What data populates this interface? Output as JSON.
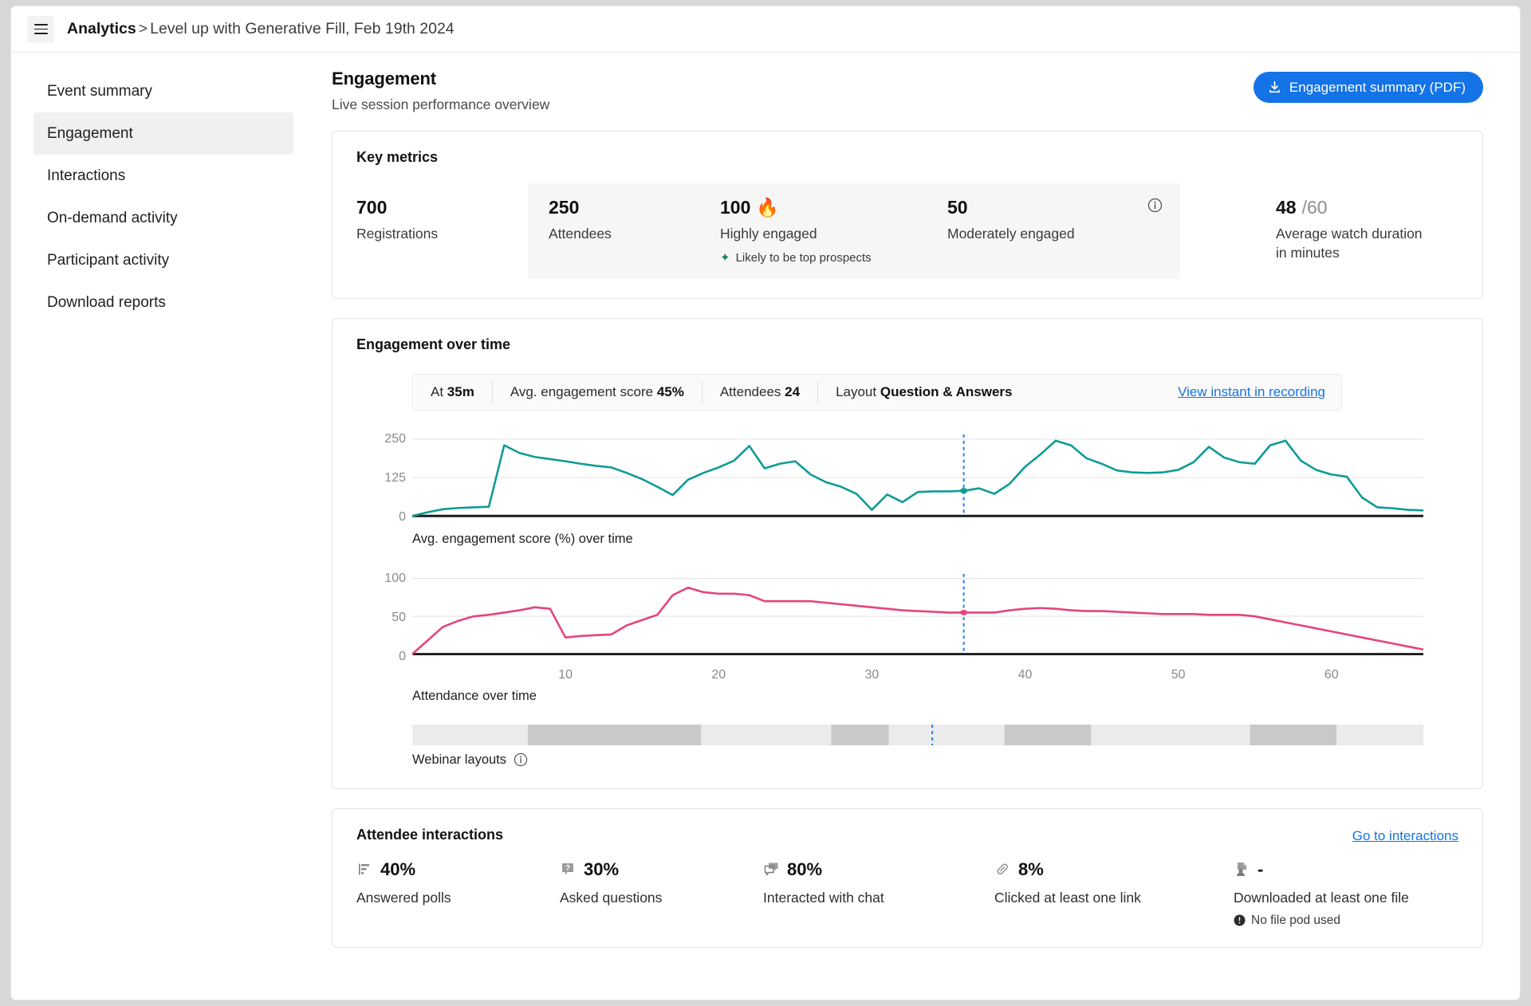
{
  "header": {
    "menu_icon": "hamburger-icon",
    "breadcrumb_root": "Analytics",
    "breadcrumb_sep": ">",
    "breadcrumb_current": "Level up with Generative Fill, Feb 19th 2024"
  },
  "sidebar": {
    "items": [
      {
        "label": "Event summary",
        "active": false
      },
      {
        "label": "Engagement",
        "active": true
      },
      {
        "label": "Interactions",
        "active": false
      },
      {
        "label": "On-demand activity",
        "active": false
      },
      {
        "label": "Participant activity",
        "active": false
      },
      {
        "label": "Download reports",
        "active": false
      }
    ]
  },
  "page": {
    "title": "Engagement",
    "subtitle": "Live session performance overview",
    "pdf_button": "Engagement summary (PDF)",
    "pdf_button_color": "#1473e6"
  },
  "key_metrics": {
    "title": "Key metrics",
    "registrations": {
      "value": "700",
      "label": "Registrations"
    },
    "attendees": {
      "value": "250",
      "label": "Attendees"
    },
    "highly_engaged": {
      "value": "100",
      "emoji": "🔥",
      "label": "Highly engaged",
      "note": "Likely to be top prospects",
      "note_icon": "sparkle-icon",
      "note_color": "#14855f"
    },
    "moderately_engaged": {
      "value": "50",
      "label": "Moderately engaged",
      "info_icon": "info-icon"
    },
    "avg_watch": {
      "value": "48",
      "total": "/60",
      "label_line1": "Average watch duration",
      "label_line2": "in minutes"
    }
  },
  "engagement_over_time": {
    "title": "Engagement over time",
    "tooltip": {
      "at_label": "At",
      "at_value": "35m",
      "score_label": "Avg. engagement score",
      "score_value": "45%",
      "attendees_label": "Attendees",
      "attendees_value": "24",
      "layout_label": "Layout",
      "layout_value": "Question & Answers",
      "link": "View instant in recording"
    },
    "caption_top": "Avg. engagement score (%) over time",
    "caption_bottom": "Attendance over time",
    "layouts_label": "Webinar layouts",
    "layouts_info_icon": "info-icon"
  },
  "attendee_interactions": {
    "title": "Attendee interactions",
    "link": "Go to interactions",
    "items": [
      {
        "icon": "poll-icon",
        "value": "40%",
        "label": "Answered polls"
      },
      {
        "icon": "question-icon",
        "value": "30%",
        "label": "Asked questions"
      },
      {
        "icon": "chat-icon",
        "value": "80%",
        "label": "Interacted with chat"
      },
      {
        "icon": "link-icon",
        "value": "8%",
        "label": "Clicked at least one link"
      },
      {
        "icon": "file-share-icon",
        "value": "-",
        "label": "Downloaded at least one file",
        "sub": "No file pod used",
        "sub_icon": "alert-icon"
      }
    ]
  },
  "chart_data": [
    {
      "type": "line",
      "title": "Avg. engagement score (%) over time",
      "series_name": "Avg. engagement score",
      "color": "#0f9b96",
      "xlabel": "",
      "ylabel": "",
      "ylim": [
        0,
        250
      ],
      "yticks": [
        0,
        125,
        250
      ],
      "ytick_labels": [
        "0",
        "125",
        "250"
      ],
      "xlim": [
        0,
        66
      ],
      "grid": true,
      "cursor_x": 36,
      "cursor_color": "#2680eb",
      "x": [
        0,
        1,
        2,
        3,
        4,
        5,
        6,
        7,
        8,
        9,
        10,
        11,
        12,
        13,
        14,
        15,
        16,
        17,
        18,
        19,
        20,
        21,
        22,
        23,
        24,
        25,
        26,
        27,
        28,
        29,
        30,
        31,
        32,
        33,
        34,
        35,
        36,
        37,
        38,
        39,
        40,
        41,
        42,
        43,
        44,
        45,
        46,
        47,
        48,
        49,
        50,
        51,
        52,
        53,
        54,
        55,
        56,
        57,
        58,
        59,
        60,
        61,
        62,
        63,
        64,
        65,
        66
      ],
      "y": [
        0,
        12,
        22,
        26,
        28,
        30,
        230,
        205,
        192,
        185,
        178,
        170,
        163,
        158,
        140,
        120,
        95,
        68,
        118,
        140,
        158,
        180,
        228,
        155,
        170,
        178,
        135,
        110,
        95,
        72,
        20,
        70,
        45,
        78,
        80,
        80,
        82,
        90,
        72,
        105,
        160,
        200,
        245,
        230,
        188,
        170,
        148,
        142,
        140,
        142,
        150,
        175,
        225,
        190,
        175,
        170,
        230,
        245,
        180,
        150,
        135,
        128,
        60,
        28,
        25,
        20,
        18
      ]
    },
    {
      "type": "line",
      "title": "Attendance over time",
      "series_name": "Attendance",
      "color": "#e4447f",
      "xlabel": "",
      "ylabel": "",
      "ylim": [
        0,
        100
      ],
      "yticks": [
        0,
        50,
        100
      ],
      "ytick_labels": [
        "0",
        "50",
        "100"
      ],
      "xlim": [
        0,
        66
      ],
      "xticks": [
        10,
        20,
        30,
        40,
        50,
        60
      ],
      "xtick_labels": [
        "10",
        "20",
        "30",
        "40",
        "50",
        "60"
      ],
      "grid": true,
      "cursor_x": 36,
      "cursor_color": "#2680eb",
      "x": [
        0,
        1,
        2,
        3,
        4,
        5,
        6,
        7,
        8,
        9,
        10,
        11,
        12,
        13,
        14,
        15,
        16,
        17,
        18,
        19,
        20,
        21,
        22,
        23,
        24,
        25,
        26,
        27,
        28,
        29,
        30,
        31,
        32,
        33,
        34,
        35,
        36,
        37,
        38,
        39,
        40,
        41,
        42,
        43,
        44,
        45,
        46,
        47,
        48,
        49,
        50,
        51,
        52,
        53,
        54,
        55,
        56,
        57,
        58,
        59,
        60,
        61,
        62,
        63,
        64,
        65,
        66
      ],
      "y": [
        0,
        18,
        36,
        44,
        50,
        52,
        55,
        58,
        62,
        60,
        22,
        24,
        25,
        26,
        38,
        45,
        52,
        78,
        88,
        82,
        80,
        80,
        78,
        70,
        70,
        70,
        70,
        68,
        66,
        64,
        62,
        60,
        58,
        57,
        56,
        55,
        55,
        55,
        55,
        58,
        60,
        61,
        60,
        58,
        57,
        57,
        56,
        55,
        54,
        53,
        53,
        53,
        52,
        52,
        52,
        50,
        46,
        42,
        38,
        34,
        30,
        26,
        22,
        18,
        14,
        10,
        6
      ]
    },
    {
      "type": "bar",
      "title": "Webinar layouts",
      "orientation": "horizontal-timeline",
      "segments": [
        {
          "start": 0,
          "end": 8,
          "shade": "#ebebeb"
        },
        {
          "start": 8,
          "end": 20,
          "shade": "#c9c9c9"
        },
        {
          "start": 20,
          "end": 29,
          "shade": "#ebebeb"
        },
        {
          "start": 29,
          "end": 33,
          "shade": "#c9c9c9"
        },
        {
          "start": 33,
          "end": 41,
          "shade": "#ebebeb"
        },
        {
          "start": 41,
          "end": 47,
          "shade": "#c9c9c9"
        },
        {
          "start": 47,
          "end": 58,
          "shade": "#ebebeb"
        },
        {
          "start": 58,
          "end": 64,
          "shade": "#c9c9c9"
        },
        {
          "start": 64,
          "end": 70,
          "shade": "#ebebeb"
        }
      ],
      "cursor_x": 36,
      "cursor_color": "#2680eb"
    }
  ]
}
